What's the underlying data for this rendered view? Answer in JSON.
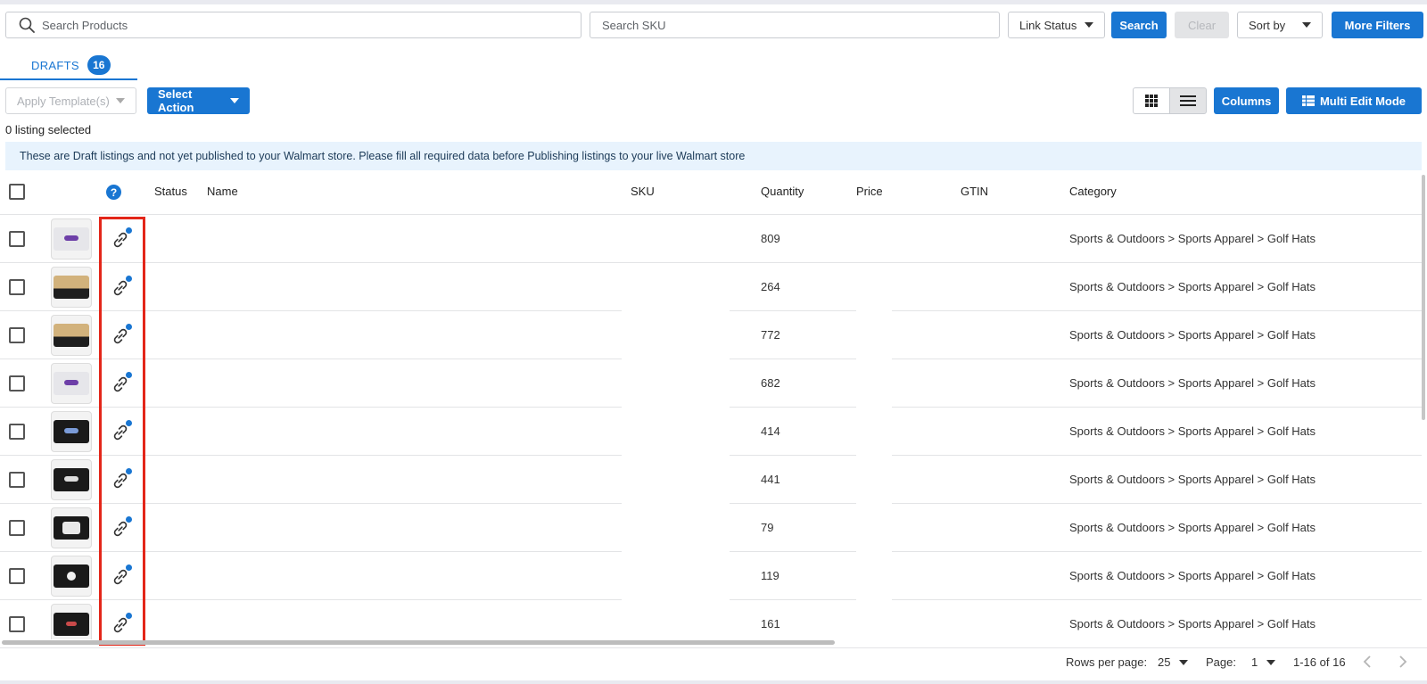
{
  "toolbar": {
    "search_products_placeholder": "Search Products",
    "search_sku_placeholder": "Search SKU",
    "link_status_label": "Link Status",
    "search_label": "Search",
    "clear_label": "Clear",
    "sort_by_label": "Sort by",
    "more_filters_label": "More Filters"
  },
  "tabs": [
    {
      "label": "DRAFTS",
      "count": "16"
    }
  ],
  "actions": {
    "apply_template_label": "Apply Template(s)",
    "select_action_label": "Select Action",
    "columns_label": "Columns",
    "multi_edit_label": "Multi Edit Mode"
  },
  "selection_text": "0 listing selected",
  "banner_text": "These are Draft listings and not yet published to your Walmart store.  Please fill all required data before Publishing listings to your live Walmart store",
  "table": {
    "help_icon": "?",
    "columns": [
      "Status",
      "Name",
      "SKU",
      "Quantity",
      "Price",
      "GTIN",
      "Category"
    ],
    "rows": [
      {
        "image": "white-cap",
        "quantity": "809",
        "category": "Sports & Outdoors > Sports Apparel > Golf Hats"
      },
      {
        "image": "tan-cap",
        "quantity": "264",
        "category": "Sports & Outdoors > Sports Apparel > Golf Hats"
      },
      {
        "image": "tan-cap",
        "quantity": "772",
        "category": "Sports & Outdoors > Sports Apparel > Golf Hats"
      },
      {
        "image": "white-cap",
        "quantity": "682",
        "category": "Sports & Outdoors > Sports Apparel > Golf Hats"
      },
      {
        "image": "black-cap",
        "quantity": "414",
        "category": "Sports & Outdoors > Sports Apparel > Golf Hats"
      },
      {
        "image": "black-cap",
        "quantity": "441",
        "category": "Sports & Outdoors > Sports Apparel > Golf Hats"
      },
      {
        "image": "black-cap",
        "quantity": "79",
        "category": "Sports & Outdoors > Sports Apparel > Golf Hats"
      },
      {
        "image": "black-cap",
        "quantity": "119",
        "category": "Sports & Outdoors > Sports Apparel > Golf Hats"
      },
      {
        "image": "black-cap",
        "quantity": "161",
        "category": "Sports & Outdoors > Sports Apparel > Golf Hats"
      }
    ]
  },
  "pagination": {
    "rows_per_page_label": "Rows per page:",
    "rows_per_page_value": "25",
    "page_label": "Page:",
    "page_value": "1",
    "range_text": "1-16 of 16"
  },
  "icons": [
    "search-icon",
    "grid-view-icon",
    "list-view-icon",
    "table-edit-icon",
    "link-icon",
    "help-icon",
    "chevron-left-icon",
    "chevron-right-icon"
  ],
  "colors": {
    "primary": "#1976d2",
    "highlight": "#e32619",
    "banner": "#e8f3fd"
  }
}
